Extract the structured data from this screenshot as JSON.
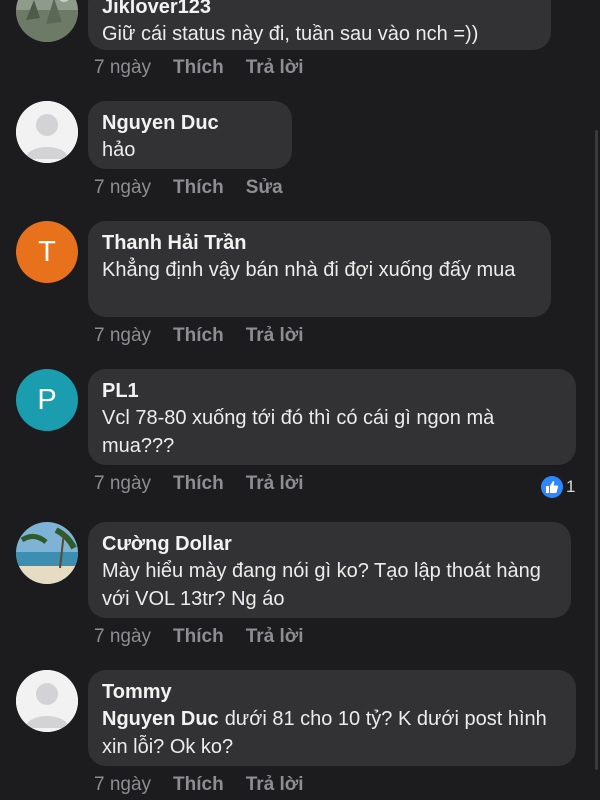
{
  "comments": [
    {
      "name": "Jiklover123",
      "text": "Giữ cái status này đi, tuần sau vào nch =))",
      "time": "7 ngày",
      "like": "Thích",
      "action": "Trả lời",
      "avatar": "landscape-photo"
    },
    {
      "name": "Nguyen Duc",
      "text": "hảo",
      "time": "7 ngày",
      "like": "Thích",
      "action": "Sửa",
      "avatar": "default-user-icon"
    },
    {
      "name": "Thanh Hải Trần",
      "text": "Khẳng định vậy bán nhà đi đợi xuống đấy mua",
      "time": "7 ngày",
      "like": "Thích",
      "action": "Trả lời",
      "avatar_letter": "T",
      "avatar_color": "#e8711c"
    },
    {
      "name": "PL1",
      "text": "Vcl 78-80 xuống tới đó thì có cái gì ngon mà mua???",
      "time": "7 ngày",
      "like": "Thích",
      "action": "Trả lời",
      "avatar_letter": "P",
      "avatar_color": "#1b9db0",
      "reaction_count": "1",
      "reaction_icon": "thumbs-up-icon"
    },
    {
      "name": "Cường Dollar",
      "text": "Mày hiểu mày đang nói gì ko? Tạo lập thoát hàng với VOL 13tr? Ng áo",
      "time": "7 ngày",
      "like": "Thích",
      "action": "Trả lời",
      "avatar": "beach-photo"
    },
    {
      "name": "Tommy",
      "mention": "Nguyen Duc",
      "text": "dưới 81 cho 10 tỷ? K dưới post hình xin lỗi? Ok ko?",
      "time": "7 ngày",
      "like": "Thích",
      "action": "Trả lời",
      "avatar": "default-user-icon"
    }
  ],
  "colors": {
    "background": "#1c1c1e",
    "bubble": "#323234",
    "like_blue": "#2d88ff"
  }
}
